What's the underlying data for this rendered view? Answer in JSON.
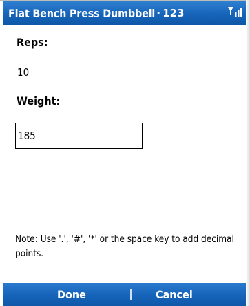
{
  "titlebar": {
    "title": "Flat Bench Press Dumbbell",
    "separator": "·",
    "input_mode": "123"
  },
  "icons": {
    "signal": "signal-strength-icon"
  },
  "form": {
    "reps_label": "Reps:",
    "reps_value": "10",
    "weight_label": "Weight:",
    "weight_value": "185"
  },
  "note": "Note: Use '.', '#', '*' or the space key to add decimal points.",
  "softkeys": {
    "left": "Done",
    "right": "Cancel"
  },
  "colors": {
    "bar_blue": "#1664b9",
    "text": "#000000",
    "background": "#ffffff"
  }
}
